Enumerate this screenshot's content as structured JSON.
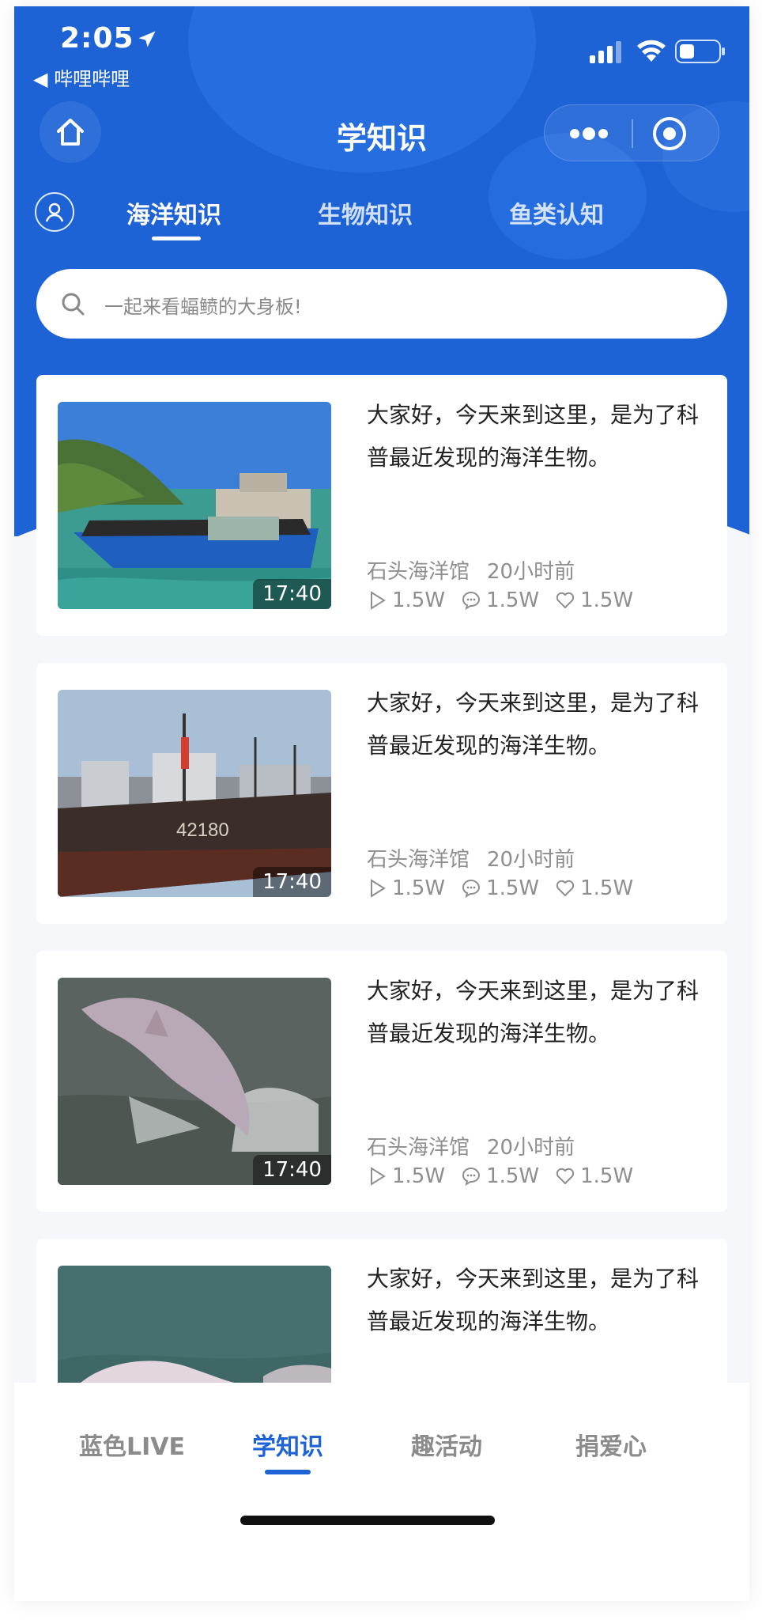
{
  "status": {
    "time": "2:05",
    "back_app": "◀ 哔哩哔哩"
  },
  "nav": {
    "title": "学知识"
  },
  "tabs": [
    {
      "label": "海洋知识",
      "active": true
    },
    {
      "label": "生物知识",
      "active": false
    },
    {
      "label": "鱼类认知",
      "active": false
    }
  ],
  "search": {
    "placeholder": "一起来看蝠鲼的大身板!"
  },
  "cards": [
    {
      "title": "大家好，今天来到这里，是为了科普最近发现的海洋生物。",
      "duration": "17:40",
      "source": "石头海洋馆",
      "time": "20小时前",
      "plays": "1.5W",
      "comments": "1.5W",
      "likes": "1.5W",
      "thumb": "fishing-boat"
    },
    {
      "title": "大家好，今天来到这里，是为了科普最近发现的海洋生物。",
      "duration": "17:40",
      "source": "石头海洋馆",
      "time": "20小时前",
      "plays": "1.5W",
      "comments": "1.5W",
      "likes": "1.5W",
      "thumb": "ships-harbor"
    },
    {
      "title": "大家好，今天来到这里，是为了科普最近发现的海洋生物。",
      "duration": "17:40",
      "source": "石头海洋馆",
      "time": "20小时前",
      "plays": "1.5W",
      "comments": "1.5W",
      "likes": "1.5W",
      "thumb": "dolphin-jump"
    },
    {
      "title": "大家好，今天来到这里，是为了科普最近发现的海洋生物。",
      "thumb": "dolphins-swim"
    }
  ],
  "tabbar": [
    {
      "label": "蓝色LIVE",
      "active": false
    },
    {
      "label": "学知识",
      "active": true
    },
    {
      "label": "趣活动",
      "active": false
    },
    {
      "label": "捐爱心",
      "active": false
    }
  ],
  "colors": {
    "primary": "#1e63d6",
    "background": "#f5f7fb",
    "text": "#222222",
    "muted": "#8e8e8e"
  }
}
